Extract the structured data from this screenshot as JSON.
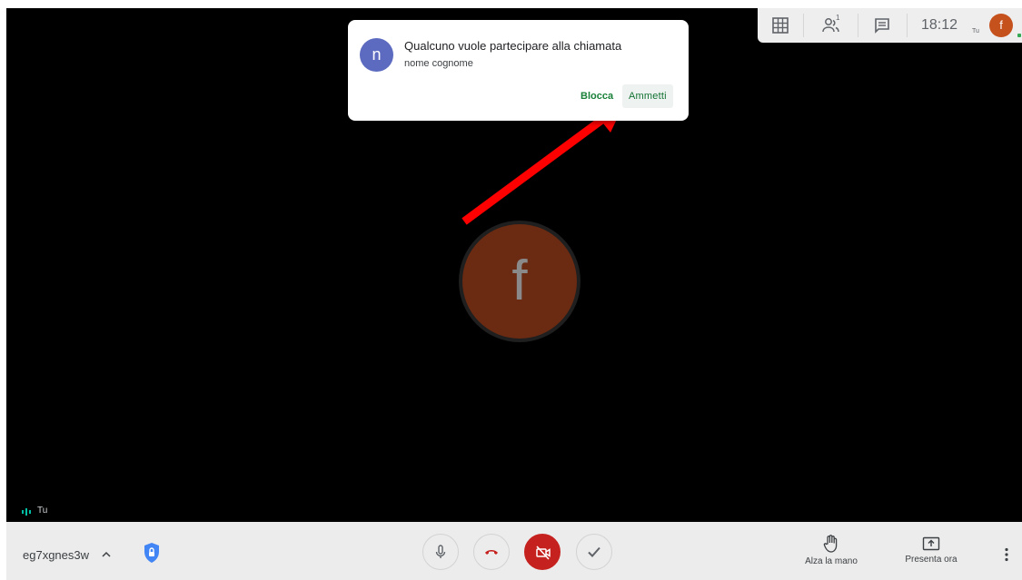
{
  "join_request": {
    "avatar_letter": "n",
    "title": "Qualcuno vuole partecipare alla chiamata",
    "name": "nome cognome",
    "block_label": "Blocca",
    "admit_label": "Ammetti"
  },
  "top_bar": {
    "clock": "18:12",
    "participants_count": "1",
    "self_label": "Tu",
    "self_avatar_letter": "f",
    "icons": [
      "grid-layout-icon",
      "people-icon",
      "chat-icon"
    ]
  },
  "main": {
    "avatar_letter": "f",
    "self_tile_label": "Tu"
  },
  "bottom_bar": {
    "meeting_code": "eg7xgnes3w",
    "raise_hand_label": "Alza la mano",
    "present_label": "Presenta ora"
  },
  "colors": {
    "accent_green": "#137333",
    "request_avatar": "#5c6bc0",
    "self_avatar": "#c5511d",
    "camera_off_red": "#c5221f",
    "annotation_arrow": "#ff0000"
  }
}
